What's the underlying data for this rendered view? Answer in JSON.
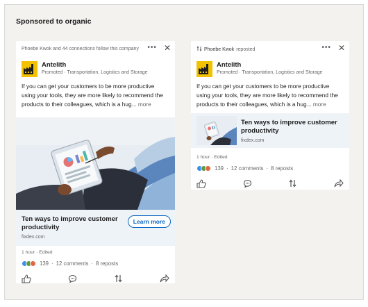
{
  "section_title": "Sponsored to organic",
  "sponsored_card": {
    "social_context": "Phoebe Kwok and 44 connections follow this company",
    "more_icon": "ellipsis-icon",
    "close_icon": "close-icon",
    "author": {
      "name": "Antelith",
      "subtitle": "Promoted · Transportation, Logistics and Storage",
      "logo_icon": "factory-logo-icon"
    },
    "body": "If you can get your customers to be more productive using your tools, they are more likely to recommend the products to their colleagues, which is a hug...",
    "more_label": "more",
    "link": {
      "title": "Ten ways to improve customer productivity",
      "domain": "fixdex.com",
      "cta": "Learn more"
    },
    "meta": "1 hour · Edited",
    "social_counts": {
      "reactions": "139",
      "comments": "12 comments",
      "reposts": "8 reposts",
      "separator": "·"
    },
    "actions": [
      "like-icon",
      "comment-icon",
      "repost-icon",
      "send-icon"
    ]
  },
  "organic_card": {
    "social_context": {
      "name": "Phoebe Kwok",
      "action": "reposted",
      "icon": "repost-icon"
    },
    "author": {
      "name": "Antelith",
      "subtitle": "Promoted · Transportation, Logistics and Storage",
      "logo_icon": "factory-logo-icon"
    },
    "body": "If you can get your customers to be more productive using your tools, they are more likely to recommend the products to their colleagues, which is a hug...",
    "more_label": "more",
    "link": {
      "title": "Ten ways to improve customer productivity",
      "domain": "fixdex.com"
    },
    "meta": "1 hour · Edited",
    "social_counts": {
      "reactions": "139",
      "comments": "12 comments",
      "reposts": "8 reposts",
      "separator": "·"
    },
    "actions": [
      "like-icon",
      "comment-icon",
      "repost-icon",
      "send-icon"
    ]
  },
  "colors": {
    "background": "#f3f2ef",
    "brand_yellow": "#f2c200",
    "link_bar": "#eef3f8",
    "cta_blue": "#0a66c2",
    "reaction_blue": "#378fe9",
    "reaction_green": "#5f9b41",
    "reaction_orange": "#e16745"
  }
}
